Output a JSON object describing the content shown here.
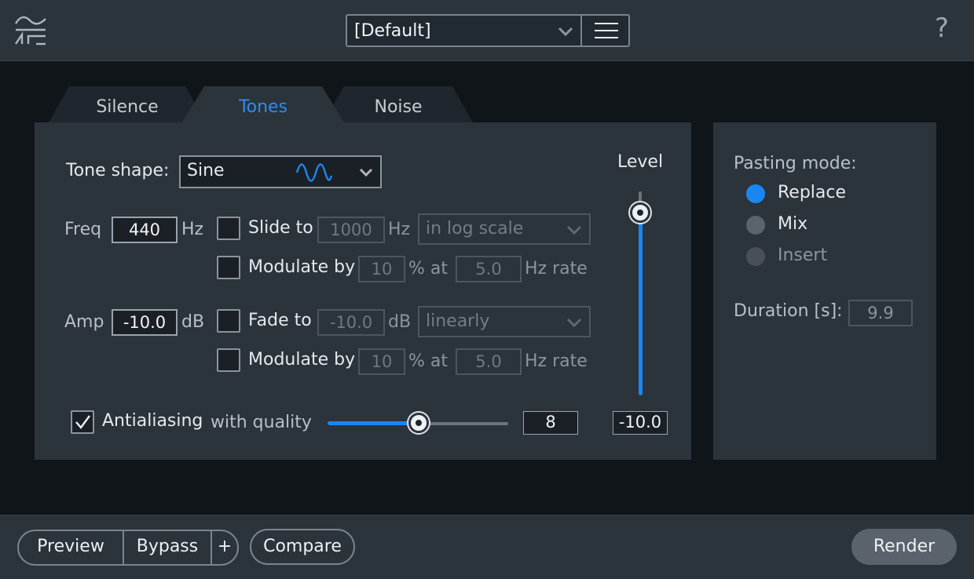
{
  "header": {
    "preset_value": "[Default]",
    "help_glyph": "?"
  },
  "tabs": [
    {
      "label": "Silence",
      "active": false
    },
    {
      "label": "Tones",
      "active": true
    },
    {
      "label": "Noise",
      "active": false
    }
  ],
  "tones": {
    "tone_shape_label": "Tone shape:",
    "tone_shape_value": "Sine",
    "freq": {
      "label": "Freq",
      "value": "440",
      "unit": "Hz",
      "slide_label": "Slide to",
      "slide_value": "1000",
      "slide_unit": "Hz",
      "scale_option": "in log scale",
      "modulate_label": "Modulate by",
      "modulate_value": "10",
      "modulate_unit": "% at",
      "rate_value": "5.0",
      "rate_unit": "Hz rate"
    },
    "amp": {
      "label": "Amp",
      "value": "-10.0",
      "unit": "dB",
      "fade_label": "Fade to",
      "fade_value": "-10.0",
      "fade_unit": "dB",
      "curve_option": "linearly",
      "modulate_label": "Modulate by",
      "modulate_value": "10",
      "modulate_unit": "% at",
      "rate_value": "5.0",
      "rate_unit": "Hz rate"
    },
    "antialiasing": {
      "label": "Antialiasing",
      "checked": true,
      "quality_label": "with quality",
      "quality_value": "8",
      "quality_fraction": 0.5
    },
    "level": {
      "label": "Level",
      "value": "-10.0",
      "fraction": 1.0
    }
  },
  "pasting": {
    "label": "Pasting mode:",
    "options": [
      {
        "label": "Replace",
        "state": "selected"
      },
      {
        "label": "Mix",
        "state": "unselected"
      },
      {
        "label": "Insert",
        "state": "disabled"
      }
    ],
    "duration_label": "Duration [s]:",
    "duration_value": "9.9"
  },
  "footer": {
    "preview": "Preview",
    "bypass": "Bypass",
    "plus": "+",
    "compare": "Compare",
    "render": "Render"
  },
  "colors": {
    "accent": "#1b86f2",
    "panel": "#2b333b",
    "background": "#101519"
  }
}
